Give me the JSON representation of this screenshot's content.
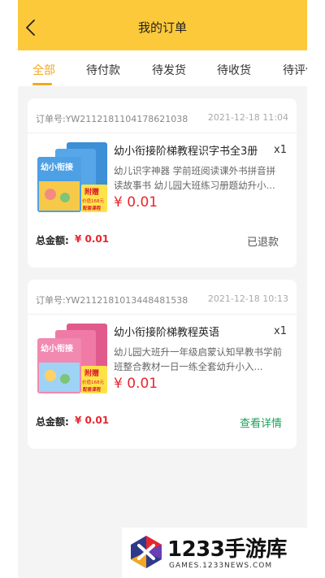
{
  "header": {
    "title": "我的订单",
    "back_icon": "chevron-left-icon"
  },
  "tabs": [
    {
      "label": "全部",
      "active": true
    },
    {
      "label": "待付款",
      "active": false
    },
    {
      "label": "待发货",
      "active": false
    },
    {
      "label": "待收货",
      "active": false
    },
    {
      "label": "待评价",
      "active": false
    }
  ],
  "orders": [
    {
      "order_no": "订单号:YW2112181104178621038",
      "date": "2021-12-18 11:04",
      "product_title": "幼小衔接阶梯教程识字书全3册",
      "quantity": "x1",
      "description": "幼儿识字神器 学前班阅读课外书拼音拼读故事书 幼儿园大班练习册题幼升小...",
      "price": "¥ 0.01",
      "total_label": "总金额:",
      "total_value": "¥ 0.01",
      "status": "已退款",
      "cover": {
        "title": "幼小衔接",
        "bonus": "附赠",
        "bonus_price": "价值168元",
        "bonus_item": "配套课程"
      }
    },
    {
      "order_no": "订单号:YW2112181013448481538",
      "date": "2021-12-18 10:13",
      "product_title": "幼小衔接阶梯教程英语",
      "quantity": "x1",
      "description": "幼儿园大班升一年级启蒙认知早教书学前班整合教材一日一练全套幼升小入...",
      "price": "¥ 0.01",
      "total_label": "总金额:",
      "total_value": "¥ 0.01",
      "action": "查看详情",
      "cover": {
        "title": "幼小衔接",
        "bonus": "附赠",
        "bonus_price": "价值168元",
        "bonus_item": "配套课程"
      }
    }
  ],
  "watermark": {
    "main": "1233手游库",
    "sub": "GAMES.1233NEWS.COM"
  },
  "colors": {
    "header": "#fcc93a",
    "accent": "#f4a81f",
    "price": "#e8262e",
    "link": "#1aa25a"
  }
}
